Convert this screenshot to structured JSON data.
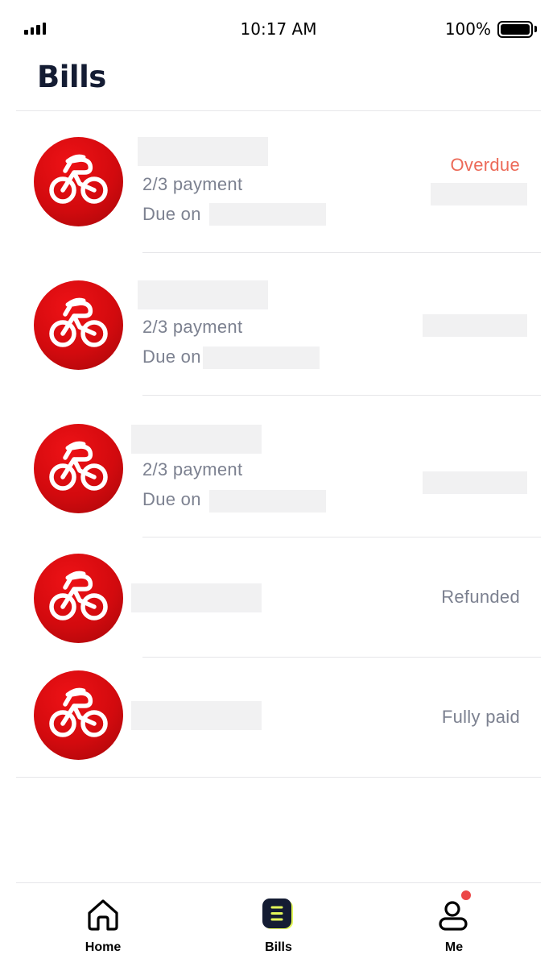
{
  "status_bar": {
    "time": "10:17 AM",
    "battery_percent": "100%",
    "signal_icon": "signal-bars-icon",
    "battery_icon": "battery-full-icon"
  },
  "header": {
    "title": "Bills"
  },
  "bills": [
    {
      "installment": "2/3 payment",
      "due_label": "Due on",
      "status": "Overdue",
      "status_color": "#ec6a58",
      "icon": "bicycle-logo-icon"
    },
    {
      "installment": "2/3 payment",
      "due_label": "Due on",
      "status": "",
      "icon": "bicycle-logo-icon"
    },
    {
      "installment": "2/3 payment",
      "due_label": "Due on",
      "status": "",
      "icon": "bicycle-logo-icon"
    },
    {
      "installment": "",
      "due_label": "",
      "status": "Refunded",
      "status_color": "#7c8190",
      "icon": "bicycle-logo-icon"
    },
    {
      "installment": "",
      "due_label": "",
      "status": "Fully paid",
      "status_color": "#7c8190",
      "icon": "bicycle-logo-icon"
    }
  ],
  "tab_bar": {
    "tabs": [
      {
        "label": "Home",
        "icon": "home-icon"
      },
      {
        "label": "Bills",
        "icon": "bills-icon",
        "active": true
      },
      {
        "label": "Me",
        "icon": "profile-icon",
        "badge": true
      }
    ],
    "accent_color": "#e3f75a",
    "badge_color": "#ec4747"
  }
}
